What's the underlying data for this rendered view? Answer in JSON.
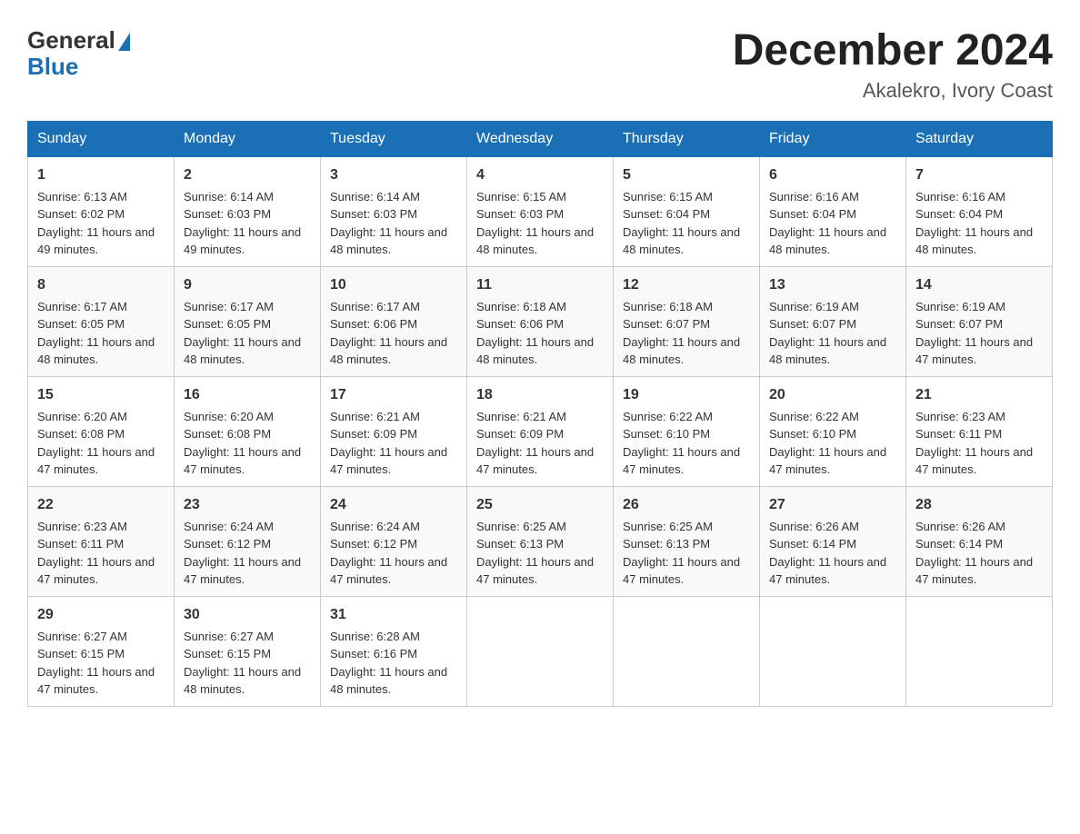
{
  "header": {
    "logo_line1": "General",
    "logo_line2": "Blue",
    "month_title": "December 2024",
    "location": "Akalekro, Ivory Coast"
  },
  "weekdays": [
    "Sunday",
    "Monday",
    "Tuesday",
    "Wednesday",
    "Thursday",
    "Friday",
    "Saturday"
  ],
  "weeks": [
    [
      {
        "day": "1",
        "sunrise": "6:13 AM",
        "sunset": "6:02 PM",
        "daylight": "11 hours and 49 minutes."
      },
      {
        "day": "2",
        "sunrise": "6:14 AM",
        "sunset": "6:03 PM",
        "daylight": "11 hours and 49 minutes."
      },
      {
        "day": "3",
        "sunrise": "6:14 AM",
        "sunset": "6:03 PM",
        "daylight": "11 hours and 48 minutes."
      },
      {
        "day": "4",
        "sunrise": "6:15 AM",
        "sunset": "6:03 PM",
        "daylight": "11 hours and 48 minutes."
      },
      {
        "day": "5",
        "sunrise": "6:15 AM",
        "sunset": "6:04 PM",
        "daylight": "11 hours and 48 minutes."
      },
      {
        "day": "6",
        "sunrise": "6:16 AM",
        "sunset": "6:04 PM",
        "daylight": "11 hours and 48 minutes."
      },
      {
        "day": "7",
        "sunrise": "6:16 AM",
        "sunset": "6:04 PM",
        "daylight": "11 hours and 48 minutes."
      }
    ],
    [
      {
        "day": "8",
        "sunrise": "6:17 AM",
        "sunset": "6:05 PM",
        "daylight": "11 hours and 48 minutes."
      },
      {
        "day": "9",
        "sunrise": "6:17 AM",
        "sunset": "6:05 PM",
        "daylight": "11 hours and 48 minutes."
      },
      {
        "day": "10",
        "sunrise": "6:17 AM",
        "sunset": "6:06 PM",
        "daylight": "11 hours and 48 minutes."
      },
      {
        "day": "11",
        "sunrise": "6:18 AM",
        "sunset": "6:06 PM",
        "daylight": "11 hours and 48 minutes."
      },
      {
        "day": "12",
        "sunrise": "6:18 AM",
        "sunset": "6:07 PM",
        "daylight": "11 hours and 48 minutes."
      },
      {
        "day": "13",
        "sunrise": "6:19 AM",
        "sunset": "6:07 PM",
        "daylight": "11 hours and 48 minutes."
      },
      {
        "day": "14",
        "sunrise": "6:19 AM",
        "sunset": "6:07 PM",
        "daylight": "11 hours and 47 minutes."
      }
    ],
    [
      {
        "day": "15",
        "sunrise": "6:20 AM",
        "sunset": "6:08 PM",
        "daylight": "11 hours and 47 minutes."
      },
      {
        "day": "16",
        "sunrise": "6:20 AM",
        "sunset": "6:08 PM",
        "daylight": "11 hours and 47 minutes."
      },
      {
        "day": "17",
        "sunrise": "6:21 AM",
        "sunset": "6:09 PM",
        "daylight": "11 hours and 47 minutes."
      },
      {
        "day": "18",
        "sunrise": "6:21 AM",
        "sunset": "6:09 PM",
        "daylight": "11 hours and 47 minutes."
      },
      {
        "day": "19",
        "sunrise": "6:22 AM",
        "sunset": "6:10 PM",
        "daylight": "11 hours and 47 minutes."
      },
      {
        "day": "20",
        "sunrise": "6:22 AM",
        "sunset": "6:10 PM",
        "daylight": "11 hours and 47 minutes."
      },
      {
        "day": "21",
        "sunrise": "6:23 AM",
        "sunset": "6:11 PM",
        "daylight": "11 hours and 47 minutes."
      }
    ],
    [
      {
        "day": "22",
        "sunrise": "6:23 AM",
        "sunset": "6:11 PM",
        "daylight": "11 hours and 47 minutes."
      },
      {
        "day": "23",
        "sunrise": "6:24 AM",
        "sunset": "6:12 PM",
        "daylight": "11 hours and 47 minutes."
      },
      {
        "day": "24",
        "sunrise": "6:24 AM",
        "sunset": "6:12 PM",
        "daylight": "11 hours and 47 minutes."
      },
      {
        "day": "25",
        "sunrise": "6:25 AM",
        "sunset": "6:13 PM",
        "daylight": "11 hours and 47 minutes."
      },
      {
        "day": "26",
        "sunrise": "6:25 AM",
        "sunset": "6:13 PM",
        "daylight": "11 hours and 47 minutes."
      },
      {
        "day": "27",
        "sunrise": "6:26 AM",
        "sunset": "6:14 PM",
        "daylight": "11 hours and 47 minutes."
      },
      {
        "day": "28",
        "sunrise": "6:26 AM",
        "sunset": "6:14 PM",
        "daylight": "11 hours and 47 minutes."
      }
    ],
    [
      {
        "day": "29",
        "sunrise": "6:27 AM",
        "sunset": "6:15 PM",
        "daylight": "11 hours and 47 minutes."
      },
      {
        "day": "30",
        "sunrise": "6:27 AM",
        "sunset": "6:15 PM",
        "daylight": "11 hours and 48 minutes."
      },
      {
        "day": "31",
        "sunrise": "6:28 AM",
        "sunset": "6:16 PM",
        "daylight": "11 hours and 48 minutes."
      },
      null,
      null,
      null,
      null
    ]
  ]
}
